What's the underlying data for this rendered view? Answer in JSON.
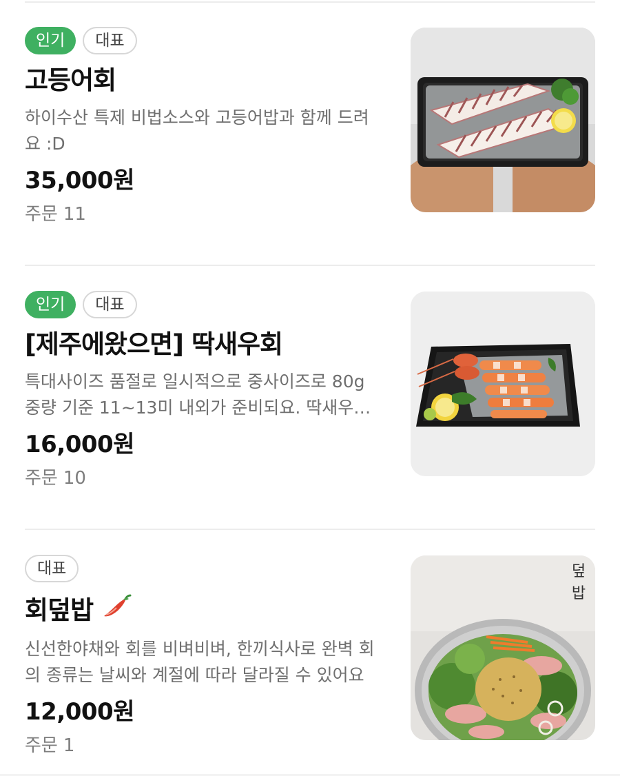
{
  "menu": {
    "items": [
      {
        "badges": {
          "popular": "인기",
          "signature": "대표"
        },
        "name": "고등어회",
        "description": "하이수산 특제 비법소스와 고등어밥과 함께 드려요 :D",
        "price": "35,000원",
        "orders_label": "주문",
        "orders_count": "11",
        "image_icon": "mackerel-sashimi-photo"
      },
      {
        "badges": {
          "popular": "인기",
          "signature": "대표"
        },
        "name": "[제주에왔으면] 딱새우회",
        "description": "특대사이즈 품절로 일시적으로 중사이즈로 80g 중량 기준 11~13미 내외가 준비되요. 딱새우회 준비 수량이 변동될 수 있어요",
        "price": "16,000원",
        "orders_label": "주문",
        "orders_count": "10",
        "image_icon": "red-shrimp-sashimi-photo"
      },
      {
        "badges": {
          "signature": "대표"
        },
        "name": "회덮밥",
        "spicy_icon": "chili-pepper-icon",
        "description": "신선한야채와 회를 비벼비벼, 한끼식사로 완벽 회의 종류는 날씨와 계절에 따라 달라질 수 있어요",
        "price": "12,000원",
        "orders_label": "주문",
        "orders_count": "1",
        "image_icon": "raw-fish-bibimbap-photo",
        "image_caption": [
          "덮",
          "밥"
        ]
      }
    ]
  },
  "colors": {
    "popular_badge": "#3fb061",
    "text_primary": "#111111",
    "text_secondary": "#6f6f6f"
  }
}
